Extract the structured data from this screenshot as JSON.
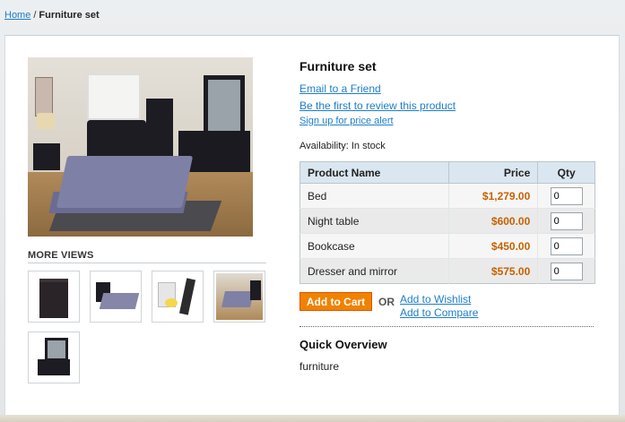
{
  "breadcrumb": {
    "home": "Home",
    "separator": "/",
    "current": "Furniture set"
  },
  "product": {
    "title": "Furniture set",
    "email_link": "Email to a Friend",
    "review_link": "Be the first to review this product",
    "price_alert_link": "Sign up for price alert",
    "availability": "Availability: In stock"
  },
  "more_views": {
    "title": "MORE VIEWS",
    "thumbs": [
      "nightstand",
      "bed",
      "lamp",
      "bedroom-set",
      "dresser-mirror"
    ]
  },
  "table": {
    "headers": {
      "name": "Product Name",
      "price": "Price",
      "qty": "Qty"
    },
    "rows": [
      {
        "name": "Bed",
        "price": "$1,279.00",
        "qty": "0"
      },
      {
        "name": "Night table",
        "price": "$600.00",
        "qty": "0"
      },
      {
        "name": "Bookcase",
        "price": "$450.00",
        "qty": "0"
      },
      {
        "name": "Dresser and mirror",
        "price": "$575.00",
        "qty": "0"
      }
    ]
  },
  "actions": {
    "add_to_cart": "Add to Cart",
    "or": "OR",
    "wishlist": "Add to Wishlist",
    "compare": "Add to Compare"
  },
  "overview": {
    "title": "Quick Overview",
    "text": "furniture"
  },
  "colors": {
    "link": "#1e7ec8",
    "price": "#c76200",
    "button": "#f18200",
    "table_header": "#dae6f0"
  }
}
